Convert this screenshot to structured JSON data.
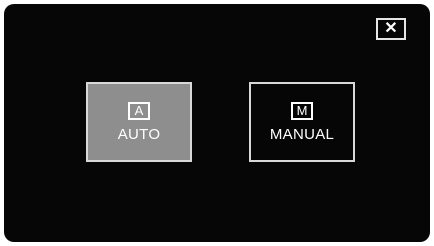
{
  "close_button": {
    "icon": "close-icon",
    "glyph": "✕"
  },
  "modes": {
    "auto": {
      "icon_letter": "A",
      "label": "AUTO",
      "selected": true
    },
    "manual": {
      "icon_letter": "M",
      "label": "MANUAL",
      "selected": false
    }
  },
  "colors": {
    "background": "#060606",
    "selected_fill": "#8e8e8e",
    "border": "#d8d8d8",
    "text": "#ffffff"
  }
}
